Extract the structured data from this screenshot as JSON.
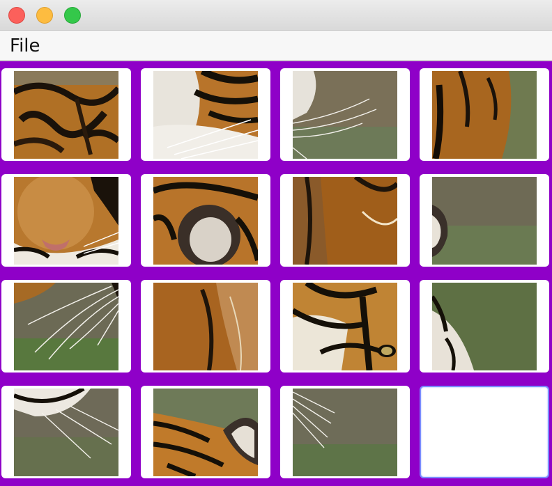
{
  "window": {
    "buttons": [
      "close",
      "minimize",
      "maximize"
    ]
  },
  "menubar": {
    "file_label": "File"
  },
  "puzzle": {
    "background_color": "#8f00c8",
    "tiles": [
      {
        "piece": "tiger-stripes-fur"
      },
      {
        "piece": "tiger-cheek-whiskers"
      },
      {
        "piece": "whiskers-on-background"
      },
      {
        "piece": "tiger-shoulder-fur"
      },
      {
        "piece": "tiger-nose"
      },
      {
        "piece": "tiger-ear"
      },
      {
        "piece": "tiger-neck-fur"
      },
      {
        "piece": "background-ear-edge"
      },
      {
        "piece": "whiskers-on-grass"
      },
      {
        "piece": "tiger-back-fur"
      },
      {
        "piece": "tiger-eye"
      },
      {
        "piece": "fur-edge-on-background"
      },
      {
        "piece": "tiger-chin-fur"
      },
      {
        "piece": "tiger-head-top-ear"
      },
      {
        "piece": "whiskers-on-background-2"
      },
      {
        "piece": "empty"
      }
    ]
  }
}
